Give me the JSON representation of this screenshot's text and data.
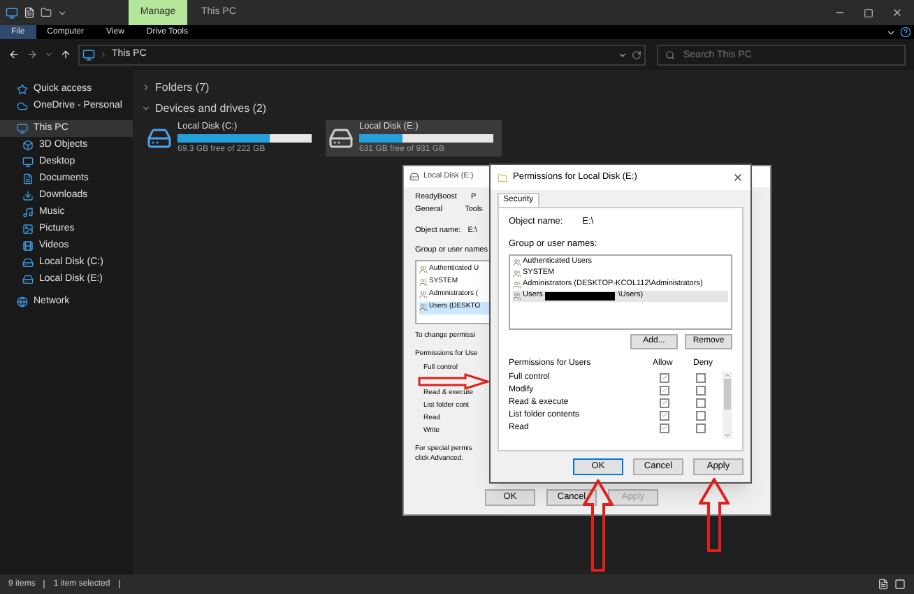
{
  "titlebar": {
    "context_tab": "Manage",
    "title": "This PC"
  },
  "ribbon_tabs": [
    {
      "label": "File",
      "selected": true
    },
    {
      "label": "Computer",
      "selected": false
    },
    {
      "label": "View",
      "selected": false
    },
    {
      "label": "Drive Tools",
      "selected": false
    }
  ],
  "address": {
    "path": "This PC",
    "search_placeholder": "Search This PC"
  },
  "sidebar": {
    "items": [
      {
        "label": "Quick access",
        "kind": "star",
        "selected": false
      },
      {
        "label": "OneDrive - Personal",
        "kind": "cloud",
        "selected": false
      },
      {
        "label": "This PC",
        "kind": "pc",
        "selected": true,
        "children": [
          {
            "label": "3D Objects",
            "kind": "cube",
            "selected": false
          },
          {
            "label": "Desktop",
            "kind": "desktop",
            "selected": false
          },
          {
            "label": "Documents",
            "kind": "document",
            "selected": false
          },
          {
            "label": "Downloads",
            "kind": "download",
            "selected": false
          },
          {
            "label": "Music",
            "kind": "music",
            "selected": false
          },
          {
            "label": "Pictures",
            "kind": "picture",
            "selected": false
          },
          {
            "label": "Videos",
            "kind": "video",
            "selected": false
          },
          {
            "label": "Local Disk (C:)",
            "kind": "drive",
            "selected": false
          },
          {
            "label": "Local Disk (E:)",
            "kind": "drive",
            "selected": false
          }
        ]
      },
      {
        "label": "Network",
        "kind": "network",
        "selected": false
      }
    ]
  },
  "groups": [
    {
      "label": "Folders (7)",
      "expanded": false
    },
    {
      "label": "Devices and drives (2)",
      "expanded": true
    }
  ],
  "drives": [
    {
      "name": "Local Disk (C:)",
      "kind": "system",
      "level": 0.69,
      "free": "69.3 GB free of 222 GB",
      "selected": false
    },
    {
      "name": "Local Disk (E:)",
      "kind": "data",
      "level": 0.32,
      "free": "631 GB free of 931 GB",
      "selected": true
    }
  ],
  "properties_dialog": {
    "title": "Local Disk (E:)",
    "tabs_row_1": [
      {
        "label": "ReadyBoost",
        "selected": false
      },
      {
        "label": "P",
        "selected": false
      }
    ],
    "tabs_row_2": [
      {
        "label": "General",
        "selected": false
      },
      {
        "label": "Tools",
        "selected": false
      }
    ],
    "object_label": "Object name:",
    "object_value": "E:\\",
    "group_label": "Group or user names",
    "users": [
      {
        "label": "Authenticated U",
        "selected": false
      },
      {
        "label": "SYSTEM",
        "selected": false
      },
      {
        "label": "Administrators (",
        "selected": false
      },
      {
        "label": "Users (DESKTO",
        "selected": true
      }
    ],
    "change_note": "To change permissi",
    "permissions_label": "Permissions for Use",
    "permissions": [
      "Full control",
      "Read & execute",
      "List folder cont",
      "Read",
      "Write"
    ],
    "special_note": [
      "For special permis",
      "click Advanced."
    ],
    "buttons": [
      {
        "label": "OK",
        "disabled": false
      },
      {
        "label": "Cancel",
        "disabled": false
      },
      {
        "label": "Apply",
        "disabled": true
      }
    ]
  },
  "permissions_dialog": {
    "title": "Permissions for Local Disk (E:)",
    "tab": "Security",
    "object_label": "Object name:",
    "object_value": "E:\\",
    "group_label": "Group or user names:",
    "users": [
      {
        "label": "Authenticated Users",
        "selected": false
      },
      {
        "label": "SYSTEM",
        "selected": false
      },
      {
        "label": "Administrators (DESKTOP-KCOL112\\Administrators)",
        "selected": false
      },
      {
        "label": "Users",
        "suffix": "\\Users)",
        "redacted": true,
        "selected": true
      }
    ],
    "list_buttons": [
      "Add...",
      "Remove"
    ],
    "permissions_label": "Permissions for Users",
    "allow_label": "Allow",
    "deny_label": "Deny",
    "permissions": [
      {
        "label": "Full control",
        "allow": true,
        "deny": false
      },
      {
        "label": "Modify",
        "allow": true,
        "deny": false
      },
      {
        "label": "Read & execute",
        "allow": true,
        "deny": false
      },
      {
        "label": "List folder contents",
        "allow": true,
        "deny": false
      },
      {
        "label": "Read",
        "allow": true,
        "deny": false
      }
    ],
    "buttons": [
      {
        "label": "OK",
        "focused": true
      },
      {
        "label": "Cancel",
        "focused": false
      },
      {
        "label": "Apply",
        "focused": false
      }
    ]
  },
  "status_bar": {
    "count": "9 items",
    "selection": "1 item selected"
  }
}
